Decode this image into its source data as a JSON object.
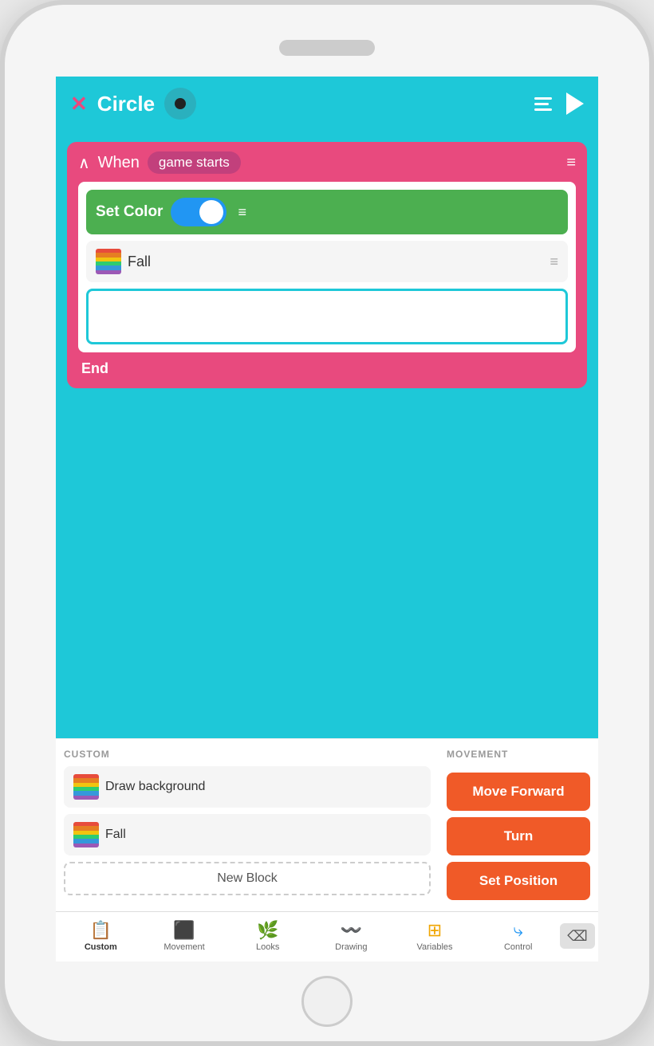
{
  "phone": {
    "header": {
      "close_icon": "✕",
      "circle_label": "Circle",
      "play_label": "▶"
    },
    "event": {
      "chevron": "∧",
      "when_text": "When",
      "trigger_badge": "game starts",
      "hamburger": "≡"
    },
    "blocks": {
      "set_color_label": "Set Color",
      "fall_label": "Fall",
      "end_label": "End"
    },
    "bottom_panel": {
      "custom_section": "CUSTOM",
      "movement_section": "MOVEMENT",
      "draw_bg_label": "Draw background",
      "fall_label": "Fall",
      "new_block_label": "New Block",
      "move_forward_label": "Move Forward",
      "turn_label": "Turn",
      "set_position_label": "Set Position"
    },
    "nav": {
      "custom_label": "Custom",
      "movement_label": "Movement",
      "looks_label": "Looks",
      "drawing_label": "Drawing",
      "variables_label": "Variables",
      "control_label": "Control"
    }
  }
}
